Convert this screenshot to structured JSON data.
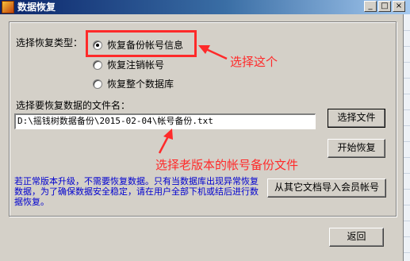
{
  "window": {
    "title": "数据恢复",
    "controls": {
      "minimize": "_",
      "maximize": "□",
      "close": "×"
    }
  },
  "restore_type": {
    "label": "选择恢复类型：",
    "options": [
      {
        "label": "恢复备份帐号信息",
        "checked": true
      },
      {
        "label": "恢复注销帐号",
        "checked": false
      },
      {
        "label": "恢复整个数据库",
        "checked": false
      }
    ]
  },
  "file": {
    "label": "选择要恢复数据的文件名：",
    "value": "D:\\摇钱树数据备份\\2015-02-04\\帐号备份.txt",
    "browse_button": "选择文件",
    "start_button": "开始恢复"
  },
  "note": "若正常版本升级，不需要恢复数据。只有当数据库出现异常恢复数据，为了确保数据安全稳定，请在用户全部下机或结后进行数据恢复。",
  "import_button": "从其它文档导入会员帐号",
  "back_button": "返回",
  "annotations": {
    "pick_this": "选择这个",
    "pick_old_file": "选择老版本的帐号备份文件",
    "color": "#ff2a2a"
  }
}
